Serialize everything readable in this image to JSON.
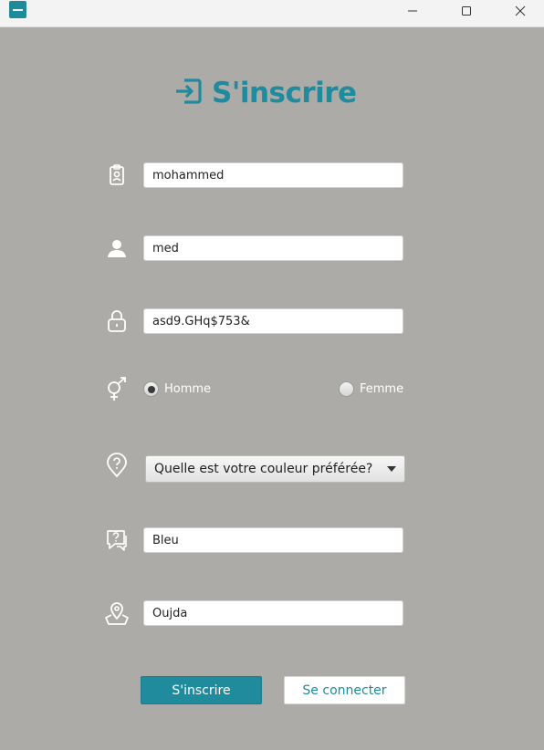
{
  "window": {
    "minimize_icon": "minimize-icon",
    "maximize_icon": "maximize-icon",
    "close_icon": "close-icon"
  },
  "header": {
    "title": "S'inscrire",
    "icon": "sign-in-icon",
    "accent_color": "#1f8b9d"
  },
  "form": {
    "full_name": {
      "value": "mohammed",
      "icon": "id-badge-icon"
    },
    "username": {
      "value": "med",
      "icon": "user-icon"
    },
    "password": {
      "value": "asd9.GHq$753&",
      "icon": "lock-icon"
    },
    "gender": {
      "icon": "gender-icon",
      "options": [
        {
          "label": "Homme",
          "selected": true
        },
        {
          "label": "Femme",
          "selected": false
        }
      ]
    },
    "security_question": {
      "icon": "question-icon",
      "selected": "Quelle est votre couleur préférée?"
    },
    "security_answer": {
      "value": "Bleu",
      "icon": "question-chat-icon"
    },
    "city": {
      "value": "Oujda",
      "icon": "map-pin-icon"
    }
  },
  "actions": {
    "register_label": "S'inscrire",
    "login_label": "Se connecter"
  },
  "colors": {
    "background": "#acaba7",
    "primary": "#1f8b9d"
  }
}
